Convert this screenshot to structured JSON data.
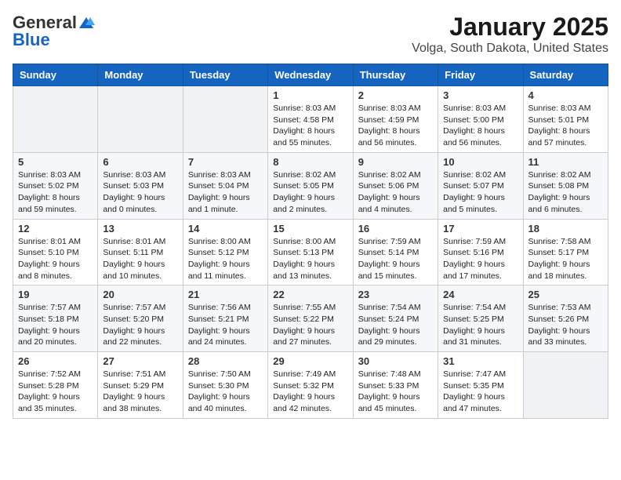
{
  "logo": {
    "general": "General",
    "blue": "Blue"
  },
  "title": "January 2025",
  "location": "Volga, South Dakota, United States",
  "weekdays": [
    "Sunday",
    "Monday",
    "Tuesday",
    "Wednesday",
    "Thursday",
    "Friday",
    "Saturday"
  ],
  "weeks": [
    [
      {
        "day": "",
        "sunrise": "",
        "sunset": "",
        "daylight": ""
      },
      {
        "day": "",
        "sunrise": "",
        "sunset": "",
        "daylight": ""
      },
      {
        "day": "",
        "sunrise": "",
        "sunset": "",
        "daylight": ""
      },
      {
        "day": "1",
        "sunrise": "Sunrise: 8:03 AM",
        "sunset": "Sunset: 4:58 PM",
        "daylight": "Daylight: 8 hours and 55 minutes."
      },
      {
        "day": "2",
        "sunrise": "Sunrise: 8:03 AM",
        "sunset": "Sunset: 4:59 PM",
        "daylight": "Daylight: 8 hours and 56 minutes."
      },
      {
        "day": "3",
        "sunrise": "Sunrise: 8:03 AM",
        "sunset": "Sunset: 5:00 PM",
        "daylight": "Daylight: 8 hours and 56 minutes."
      },
      {
        "day": "4",
        "sunrise": "Sunrise: 8:03 AM",
        "sunset": "Sunset: 5:01 PM",
        "daylight": "Daylight: 8 hours and 57 minutes."
      }
    ],
    [
      {
        "day": "5",
        "sunrise": "Sunrise: 8:03 AM",
        "sunset": "Sunset: 5:02 PM",
        "daylight": "Daylight: 8 hours and 59 minutes."
      },
      {
        "day": "6",
        "sunrise": "Sunrise: 8:03 AM",
        "sunset": "Sunset: 5:03 PM",
        "daylight": "Daylight: 9 hours and 0 minutes."
      },
      {
        "day": "7",
        "sunrise": "Sunrise: 8:03 AM",
        "sunset": "Sunset: 5:04 PM",
        "daylight": "Daylight: 9 hours and 1 minute."
      },
      {
        "day": "8",
        "sunrise": "Sunrise: 8:02 AM",
        "sunset": "Sunset: 5:05 PM",
        "daylight": "Daylight: 9 hours and 2 minutes."
      },
      {
        "day": "9",
        "sunrise": "Sunrise: 8:02 AM",
        "sunset": "Sunset: 5:06 PM",
        "daylight": "Daylight: 9 hours and 4 minutes."
      },
      {
        "day": "10",
        "sunrise": "Sunrise: 8:02 AM",
        "sunset": "Sunset: 5:07 PM",
        "daylight": "Daylight: 9 hours and 5 minutes."
      },
      {
        "day": "11",
        "sunrise": "Sunrise: 8:02 AM",
        "sunset": "Sunset: 5:08 PM",
        "daylight": "Daylight: 9 hours and 6 minutes."
      }
    ],
    [
      {
        "day": "12",
        "sunrise": "Sunrise: 8:01 AM",
        "sunset": "Sunset: 5:10 PM",
        "daylight": "Daylight: 9 hours and 8 minutes."
      },
      {
        "day": "13",
        "sunrise": "Sunrise: 8:01 AM",
        "sunset": "Sunset: 5:11 PM",
        "daylight": "Daylight: 9 hours and 10 minutes."
      },
      {
        "day": "14",
        "sunrise": "Sunrise: 8:00 AM",
        "sunset": "Sunset: 5:12 PM",
        "daylight": "Daylight: 9 hours and 11 minutes."
      },
      {
        "day": "15",
        "sunrise": "Sunrise: 8:00 AM",
        "sunset": "Sunset: 5:13 PM",
        "daylight": "Daylight: 9 hours and 13 minutes."
      },
      {
        "day": "16",
        "sunrise": "Sunrise: 7:59 AM",
        "sunset": "Sunset: 5:14 PM",
        "daylight": "Daylight: 9 hours and 15 minutes."
      },
      {
        "day": "17",
        "sunrise": "Sunrise: 7:59 AM",
        "sunset": "Sunset: 5:16 PM",
        "daylight": "Daylight: 9 hours and 17 minutes."
      },
      {
        "day": "18",
        "sunrise": "Sunrise: 7:58 AM",
        "sunset": "Sunset: 5:17 PM",
        "daylight": "Daylight: 9 hours and 18 minutes."
      }
    ],
    [
      {
        "day": "19",
        "sunrise": "Sunrise: 7:57 AM",
        "sunset": "Sunset: 5:18 PM",
        "daylight": "Daylight: 9 hours and 20 minutes."
      },
      {
        "day": "20",
        "sunrise": "Sunrise: 7:57 AM",
        "sunset": "Sunset: 5:20 PM",
        "daylight": "Daylight: 9 hours and 22 minutes."
      },
      {
        "day": "21",
        "sunrise": "Sunrise: 7:56 AM",
        "sunset": "Sunset: 5:21 PM",
        "daylight": "Daylight: 9 hours and 24 minutes."
      },
      {
        "day": "22",
        "sunrise": "Sunrise: 7:55 AM",
        "sunset": "Sunset: 5:22 PM",
        "daylight": "Daylight: 9 hours and 27 minutes."
      },
      {
        "day": "23",
        "sunrise": "Sunrise: 7:54 AM",
        "sunset": "Sunset: 5:24 PM",
        "daylight": "Daylight: 9 hours and 29 minutes."
      },
      {
        "day": "24",
        "sunrise": "Sunrise: 7:54 AM",
        "sunset": "Sunset: 5:25 PM",
        "daylight": "Daylight: 9 hours and 31 minutes."
      },
      {
        "day": "25",
        "sunrise": "Sunrise: 7:53 AM",
        "sunset": "Sunset: 5:26 PM",
        "daylight": "Daylight: 9 hours and 33 minutes."
      }
    ],
    [
      {
        "day": "26",
        "sunrise": "Sunrise: 7:52 AM",
        "sunset": "Sunset: 5:28 PM",
        "daylight": "Daylight: 9 hours and 35 minutes."
      },
      {
        "day": "27",
        "sunrise": "Sunrise: 7:51 AM",
        "sunset": "Sunset: 5:29 PM",
        "daylight": "Daylight: 9 hours and 38 minutes."
      },
      {
        "day": "28",
        "sunrise": "Sunrise: 7:50 AM",
        "sunset": "Sunset: 5:30 PM",
        "daylight": "Daylight: 9 hours and 40 minutes."
      },
      {
        "day": "29",
        "sunrise": "Sunrise: 7:49 AM",
        "sunset": "Sunset: 5:32 PM",
        "daylight": "Daylight: 9 hours and 42 minutes."
      },
      {
        "day": "30",
        "sunrise": "Sunrise: 7:48 AM",
        "sunset": "Sunset: 5:33 PM",
        "daylight": "Daylight: 9 hours and 45 minutes."
      },
      {
        "day": "31",
        "sunrise": "Sunrise: 7:47 AM",
        "sunset": "Sunset: 5:35 PM",
        "daylight": "Daylight: 9 hours and 47 minutes."
      },
      {
        "day": "",
        "sunrise": "",
        "sunset": "",
        "daylight": ""
      }
    ]
  ]
}
